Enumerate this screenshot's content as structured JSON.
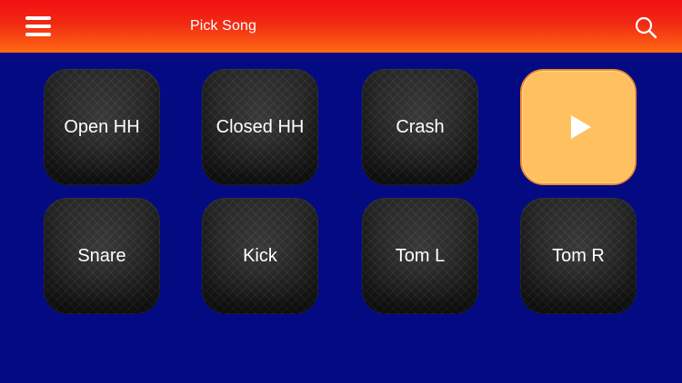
{
  "header": {
    "title": "Pick Song",
    "menu_icon": "hamburger-menu-icon",
    "search_icon": "search-icon"
  },
  "pads": [
    {
      "label": "Open HH"
    },
    {
      "label": "Closed HH"
    },
    {
      "label": "Crash"
    },
    {
      "label": ""
    },
    {
      "label": "Snare"
    },
    {
      "label": "Kick"
    },
    {
      "label": "Tom L"
    },
    {
      "label": "Tom R"
    }
  ],
  "play_button": {
    "icon": "play-icon"
  },
  "colors": {
    "background": "#040b82",
    "header_top": "#f20f12",
    "header_bottom": "#ff6a14",
    "pad": "#1f1f1f",
    "play_fill": "#ffc15f",
    "play_border": "#f48b2b",
    "text": "#ffffff"
  }
}
